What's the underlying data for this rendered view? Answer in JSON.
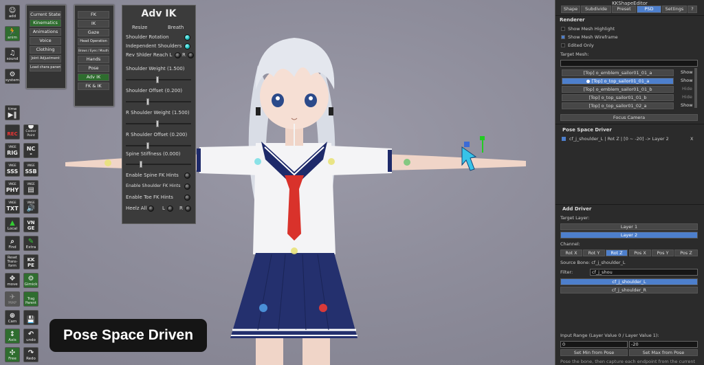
{
  "toolbar": {
    "add": "add",
    "anim": "anim",
    "sound": "sound",
    "system": "system",
    "time": "time",
    "rec": "REC",
    "center_point": "Center Point",
    "rig": "RIG",
    "nc": "NC",
    "sss": "SSS",
    "ssb": "SSB",
    "phy": "PHY",
    "txt": "TXT",
    "local": "Local",
    "vnge": "VN GE",
    "vnge_prefix": "VNGE",
    "find": "Find",
    "extra": "Extra",
    "reset_transform": "Reset Trans-form",
    "kkpe": "KK PE",
    "move": "move",
    "gimick": "Gimick",
    "map": "MAP",
    "trag": "Trag Parent",
    "cam": "Cam",
    "axis": "Axis",
    "undo": "undo",
    "free": "Free",
    "redo": "Redo"
  },
  "menu1": [
    "Current State",
    "Kinematics",
    "Animations",
    "Voice",
    "Clothing",
    "Joint Adjustment",
    "Load chara param"
  ],
  "menu2": [
    "FK",
    "IK",
    "Gaze",
    "Head Operation",
    "Brows / Eyes / Mouth",
    "Hands",
    "Pose",
    "Adv IK",
    "FK & IK"
  ],
  "adv_ik": {
    "title": "Adv IK",
    "resize": "Resize",
    "breath": "Breath",
    "shoulder_rotation": "Shoulder Rotation",
    "independent_shoulders": "Independent Shoulders",
    "rev_reach": "Rev Shlder Reach L",
    "r": "R",
    "l": "L",
    "shoulder_weight": "Shoulder Weight (1.500)",
    "shoulder_offset": "Shoulder Offset (0.200)",
    "r_shoulder_weight": "R Shoulder Weight (1.500)",
    "r_shoulder_offset": "R Shoulder Offset (0.200)",
    "spine_stiffness": "Spine Stiffness (0.000)",
    "spine_fk": "Enable Spine FK Hints",
    "shoulder_fk": "Enable Shoulder FK Hints",
    "toe_fk": "Enable Toe FK Hints",
    "heelz": "Heelz All"
  },
  "editor": {
    "title": "KKShapeEditor",
    "tabs": [
      "Shape",
      "Subdivide",
      "Preset",
      "PSD",
      "Settings",
      "?"
    ],
    "renderer": "Renderer",
    "show_highlight": "Show Mesh Highlight",
    "show_wireframe": "Show Mesh Wireframe",
    "edited_only": "Edited Only",
    "target_mesh": "Target Mesh:",
    "meshes": [
      {
        "name": "[Top] o_emblem_sailor01_01_a",
        "action": "Show"
      },
      {
        "name": "● [Top] o_top_sailor01_01_a",
        "action": "Show"
      },
      {
        "name": "[Top] o_emblem_sailor01_01_b",
        "action": "Hide"
      },
      {
        "name": "[Top] o_top_sailor01_01_b",
        "action": "Hide"
      },
      {
        "name": "[Top] o_top_sailor01_02_a",
        "action": "Show"
      }
    ],
    "focus_camera": "Focus Camera",
    "psd_title": "Pose Space Driver",
    "driver_entry": "cf_j_shoulder_L  |  Rot Z  |  [0 ~ -20]  ->  Layer 2",
    "remove": "X",
    "add_driver": "Add Driver",
    "target_layer": "Target Layer:",
    "layer1": "Layer 1",
    "layer2": "Layer 2",
    "channel": "Channel:",
    "channels": [
      "Rot X",
      "Rot Y",
      "Rot Z",
      "Pos X",
      "Pos Y",
      "Pos Z"
    ],
    "source_bone": "Source Bone: cf_j_shoulder_L",
    "filter": "Filter:",
    "filter_value": "cf_j_shou",
    "bones": [
      "cf_j_shoulder_L",
      "cf_j_shoulder_R"
    ],
    "input_range": "Input Range (Layer Value 0 / Layer Value 1):",
    "min": "0",
    "max": "-20",
    "set_min": "Set Min from Pose",
    "set_max": "Set Max from Pose",
    "hint": "Pose the bone, then capture each endpoint from the current"
  },
  "caption": "Pose Space Driven"
}
